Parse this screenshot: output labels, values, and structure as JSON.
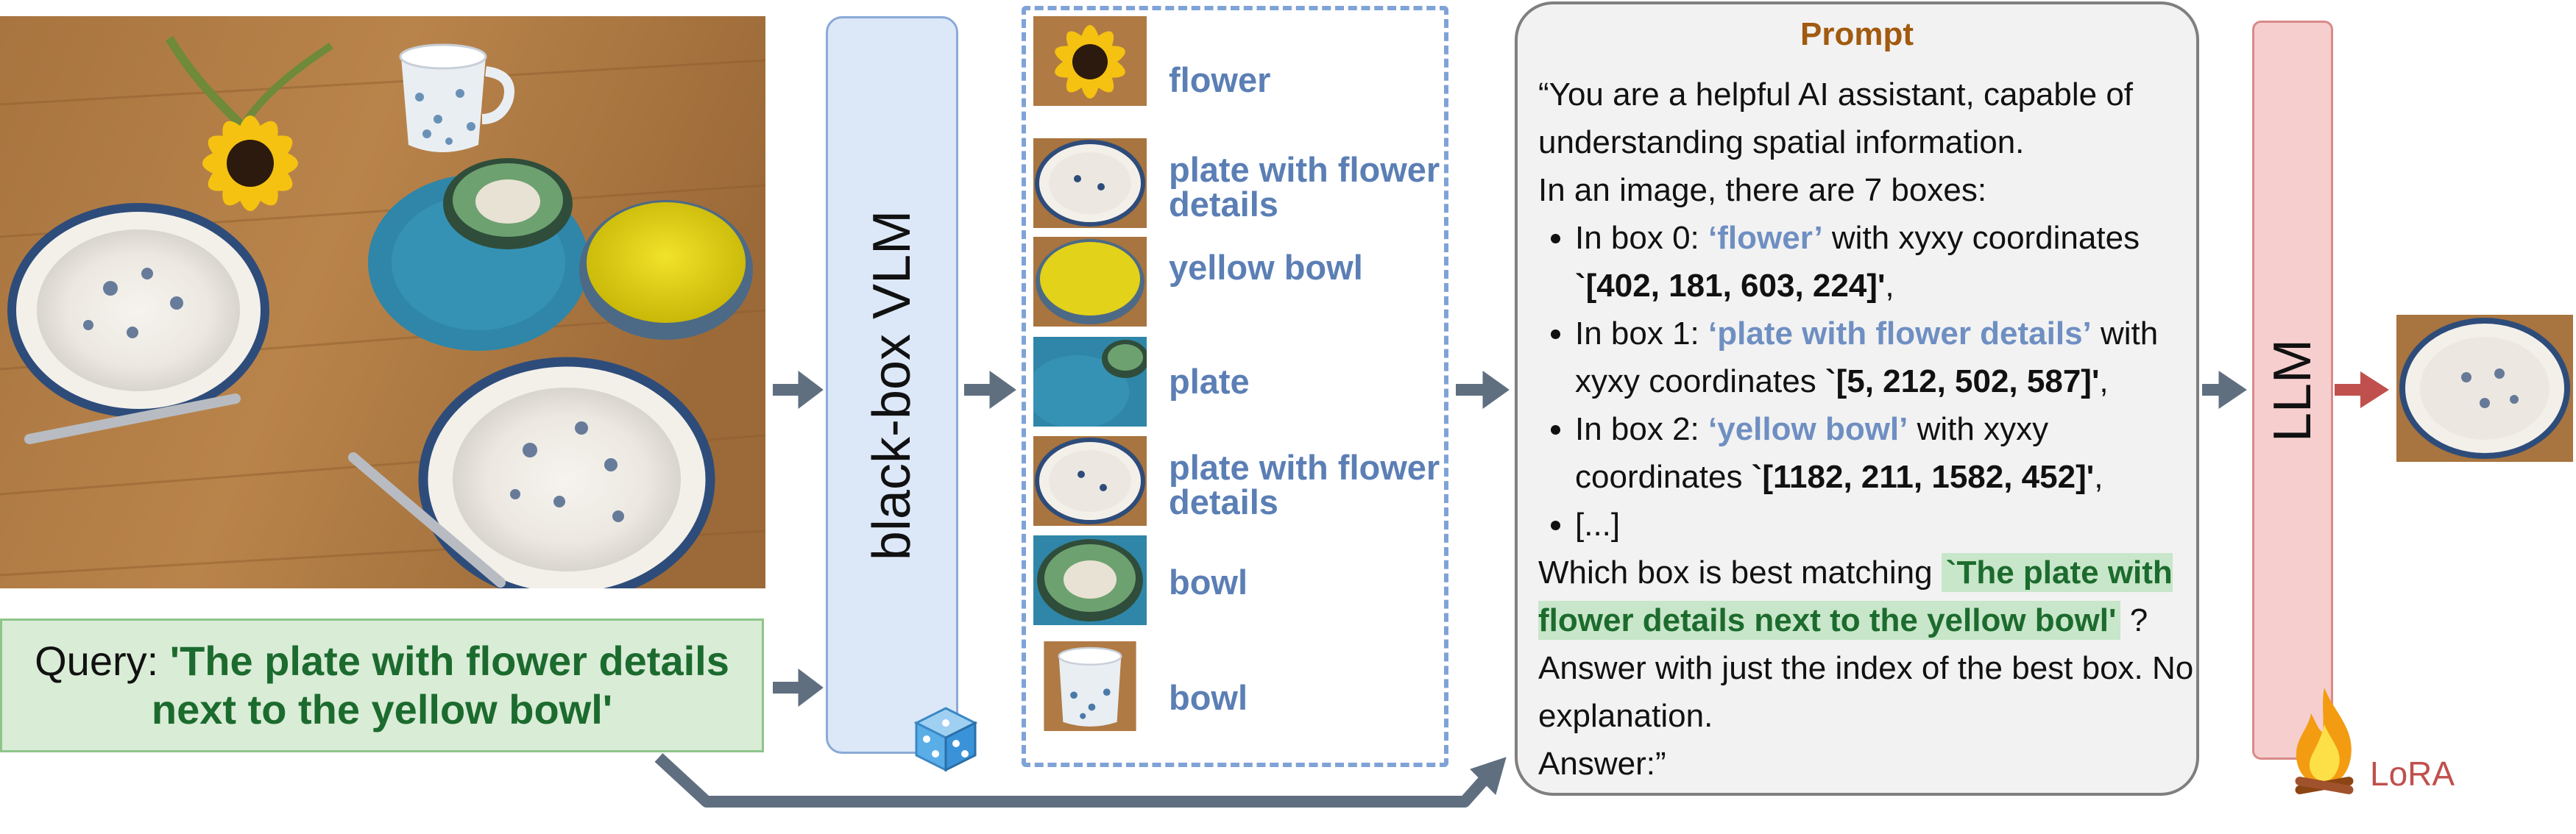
{
  "query": {
    "label": "Query:",
    "text": "'The plate with flower details next to the yellow bowl'"
  },
  "vlm": {
    "label": "black-box VLM"
  },
  "crops": [
    {
      "label": "flower"
    },
    {
      "label": "plate with flower details"
    },
    {
      "label": "yellow bowl"
    },
    {
      "label": "plate"
    },
    {
      "label": "plate with flower details"
    },
    {
      "label": "bowl"
    },
    {
      "label": "bowl"
    }
  ],
  "prompt": {
    "title": "Prompt",
    "intro": "“You are a helpful AI assistant, capable of understanding spatial information.",
    "count_line": "In an image, there are 7 boxes:",
    "boxes": [
      {
        "prefix": "In box 0: ",
        "label": "‘flower’",
        "mid": " with xyxy coordinates ",
        "coords": "`[402, 181, 603, 224]'",
        "suffix": ","
      },
      {
        "prefix": "In box 1: ",
        "label": "‘plate with flower details’",
        "mid": " with xyxy coordinates ",
        "coords": "`[5, 212, 502, 587]'",
        "suffix": ","
      },
      {
        "prefix": "In box 2: ",
        "label": "‘yellow bowl’",
        "mid": " with xyxy coordinates ",
        "coords": "`[1182, 211, 1582, 452]'",
        "suffix": ","
      }
    ],
    "ellipsis": "[...]",
    "question_pre": "Which box is best matching ",
    "question_query": "`The plate with flower details next to the yellow bowl'",
    "question_post": " ? Answer with just the index of the best box. No explanation.",
    "answer": "Answer:”"
  },
  "llm": {
    "label": "LLM"
  },
  "lora": {
    "label": "LoRA"
  },
  "colors": {
    "arrow": "#5f6f80",
    "output_arrow": "#c0504d",
    "query_green": "#1c6b2e",
    "crop_label_blue": "#5b7fb5",
    "prompt_title": "#a15a10"
  }
}
